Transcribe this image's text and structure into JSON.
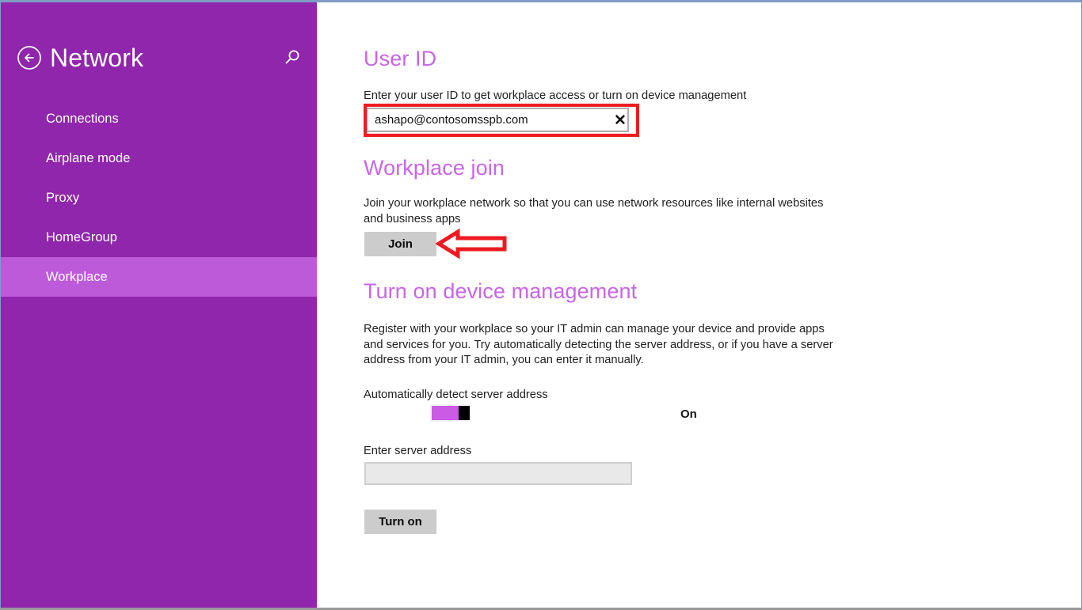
{
  "window": {
    "frame_color": "#7f9dc4",
    "accent_color": "#8f26ab",
    "heading_color": "#c965e8",
    "selected_nav_color": "#bd5ada",
    "annotation_color": "#ee1b20"
  },
  "sidebar": {
    "title": "Network",
    "back_icon": "back-arrow-circle-icon",
    "search_icon": "search-icon",
    "items": [
      {
        "label": "Connections",
        "selected": false
      },
      {
        "label": "Airplane mode",
        "selected": false
      },
      {
        "label": "Proxy",
        "selected": false
      },
      {
        "label": "HomeGroup",
        "selected": false
      },
      {
        "label": "Workplace",
        "selected": true
      }
    ]
  },
  "main": {
    "user_id": {
      "heading": "User ID",
      "description": "Enter your user ID to get workplace access or turn on device management",
      "input_value": "ashapo@contosomsspb.com",
      "input_placeholder": "",
      "clear_icon": "close-x-icon"
    },
    "workplace_join": {
      "heading": "Workplace join",
      "description": "Join your workplace network so that you can use network resources like internal websites and business apps",
      "button_label": "Join"
    },
    "device_management": {
      "heading": "Turn on device management",
      "description": "Register with your workplace so your IT admin can manage your device and provide apps and services for you. Try automatically detecting the server address, or if you have a server address from your IT admin, you can enter it manually.",
      "auto_detect_label": "Automatically detect server address",
      "toggle_state": "On",
      "server_address_label": "Enter server address",
      "server_address_value": "",
      "server_address_placeholder": "",
      "turn_on_button_label": "Turn on"
    }
  },
  "annotations": {
    "input_highlight": "red-rectangle-highlight",
    "join_pointer": "red-left-arrow-pointer"
  }
}
